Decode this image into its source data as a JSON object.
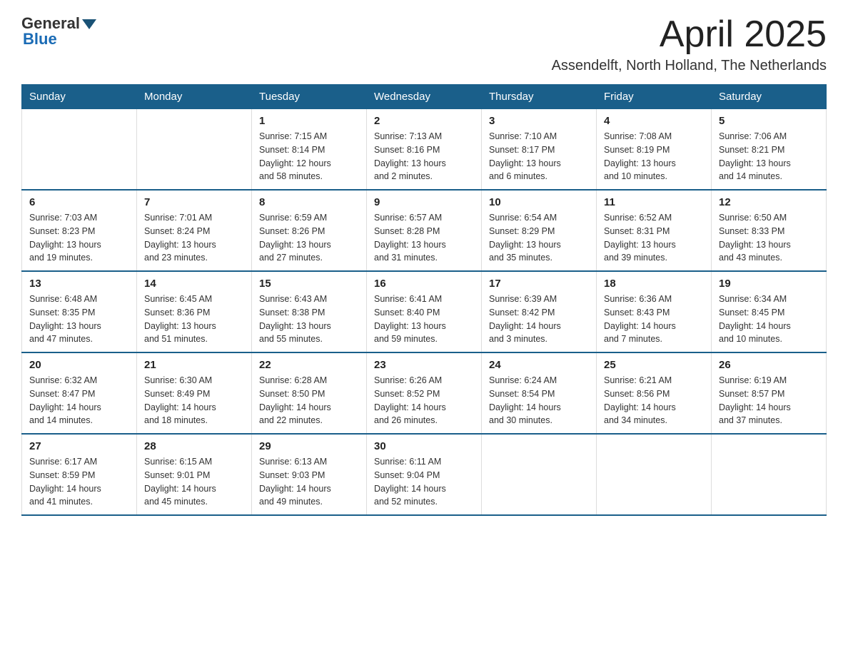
{
  "logo": {
    "general": "General",
    "blue": "Blue",
    "subtitle": "Blue"
  },
  "title": "April 2025",
  "subtitle": "Assendelft, North Holland, The Netherlands",
  "days_header": [
    "Sunday",
    "Monday",
    "Tuesday",
    "Wednesday",
    "Thursday",
    "Friday",
    "Saturday"
  ],
  "weeks": [
    [
      {
        "day": "",
        "info": ""
      },
      {
        "day": "",
        "info": ""
      },
      {
        "day": "1",
        "info": "Sunrise: 7:15 AM\nSunset: 8:14 PM\nDaylight: 12 hours\nand 58 minutes."
      },
      {
        "day": "2",
        "info": "Sunrise: 7:13 AM\nSunset: 8:16 PM\nDaylight: 13 hours\nand 2 minutes."
      },
      {
        "day": "3",
        "info": "Sunrise: 7:10 AM\nSunset: 8:17 PM\nDaylight: 13 hours\nand 6 minutes."
      },
      {
        "day": "4",
        "info": "Sunrise: 7:08 AM\nSunset: 8:19 PM\nDaylight: 13 hours\nand 10 minutes."
      },
      {
        "day": "5",
        "info": "Sunrise: 7:06 AM\nSunset: 8:21 PM\nDaylight: 13 hours\nand 14 minutes."
      }
    ],
    [
      {
        "day": "6",
        "info": "Sunrise: 7:03 AM\nSunset: 8:23 PM\nDaylight: 13 hours\nand 19 minutes."
      },
      {
        "day": "7",
        "info": "Sunrise: 7:01 AM\nSunset: 8:24 PM\nDaylight: 13 hours\nand 23 minutes."
      },
      {
        "day": "8",
        "info": "Sunrise: 6:59 AM\nSunset: 8:26 PM\nDaylight: 13 hours\nand 27 minutes."
      },
      {
        "day": "9",
        "info": "Sunrise: 6:57 AM\nSunset: 8:28 PM\nDaylight: 13 hours\nand 31 minutes."
      },
      {
        "day": "10",
        "info": "Sunrise: 6:54 AM\nSunset: 8:29 PM\nDaylight: 13 hours\nand 35 minutes."
      },
      {
        "day": "11",
        "info": "Sunrise: 6:52 AM\nSunset: 8:31 PM\nDaylight: 13 hours\nand 39 minutes."
      },
      {
        "day": "12",
        "info": "Sunrise: 6:50 AM\nSunset: 8:33 PM\nDaylight: 13 hours\nand 43 minutes."
      }
    ],
    [
      {
        "day": "13",
        "info": "Sunrise: 6:48 AM\nSunset: 8:35 PM\nDaylight: 13 hours\nand 47 minutes."
      },
      {
        "day": "14",
        "info": "Sunrise: 6:45 AM\nSunset: 8:36 PM\nDaylight: 13 hours\nand 51 minutes."
      },
      {
        "day": "15",
        "info": "Sunrise: 6:43 AM\nSunset: 8:38 PM\nDaylight: 13 hours\nand 55 minutes."
      },
      {
        "day": "16",
        "info": "Sunrise: 6:41 AM\nSunset: 8:40 PM\nDaylight: 13 hours\nand 59 minutes."
      },
      {
        "day": "17",
        "info": "Sunrise: 6:39 AM\nSunset: 8:42 PM\nDaylight: 14 hours\nand 3 minutes."
      },
      {
        "day": "18",
        "info": "Sunrise: 6:36 AM\nSunset: 8:43 PM\nDaylight: 14 hours\nand 7 minutes."
      },
      {
        "day": "19",
        "info": "Sunrise: 6:34 AM\nSunset: 8:45 PM\nDaylight: 14 hours\nand 10 minutes."
      }
    ],
    [
      {
        "day": "20",
        "info": "Sunrise: 6:32 AM\nSunset: 8:47 PM\nDaylight: 14 hours\nand 14 minutes."
      },
      {
        "day": "21",
        "info": "Sunrise: 6:30 AM\nSunset: 8:49 PM\nDaylight: 14 hours\nand 18 minutes."
      },
      {
        "day": "22",
        "info": "Sunrise: 6:28 AM\nSunset: 8:50 PM\nDaylight: 14 hours\nand 22 minutes."
      },
      {
        "day": "23",
        "info": "Sunrise: 6:26 AM\nSunset: 8:52 PM\nDaylight: 14 hours\nand 26 minutes."
      },
      {
        "day": "24",
        "info": "Sunrise: 6:24 AM\nSunset: 8:54 PM\nDaylight: 14 hours\nand 30 minutes."
      },
      {
        "day": "25",
        "info": "Sunrise: 6:21 AM\nSunset: 8:56 PM\nDaylight: 14 hours\nand 34 minutes."
      },
      {
        "day": "26",
        "info": "Sunrise: 6:19 AM\nSunset: 8:57 PM\nDaylight: 14 hours\nand 37 minutes."
      }
    ],
    [
      {
        "day": "27",
        "info": "Sunrise: 6:17 AM\nSunset: 8:59 PM\nDaylight: 14 hours\nand 41 minutes."
      },
      {
        "day": "28",
        "info": "Sunrise: 6:15 AM\nSunset: 9:01 PM\nDaylight: 14 hours\nand 45 minutes."
      },
      {
        "day": "29",
        "info": "Sunrise: 6:13 AM\nSunset: 9:03 PM\nDaylight: 14 hours\nand 49 minutes."
      },
      {
        "day": "30",
        "info": "Sunrise: 6:11 AM\nSunset: 9:04 PM\nDaylight: 14 hours\nand 52 minutes."
      },
      {
        "day": "",
        "info": ""
      },
      {
        "day": "",
        "info": ""
      },
      {
        "day": "",
        "info": ""
      }
    ]
  ]
}
